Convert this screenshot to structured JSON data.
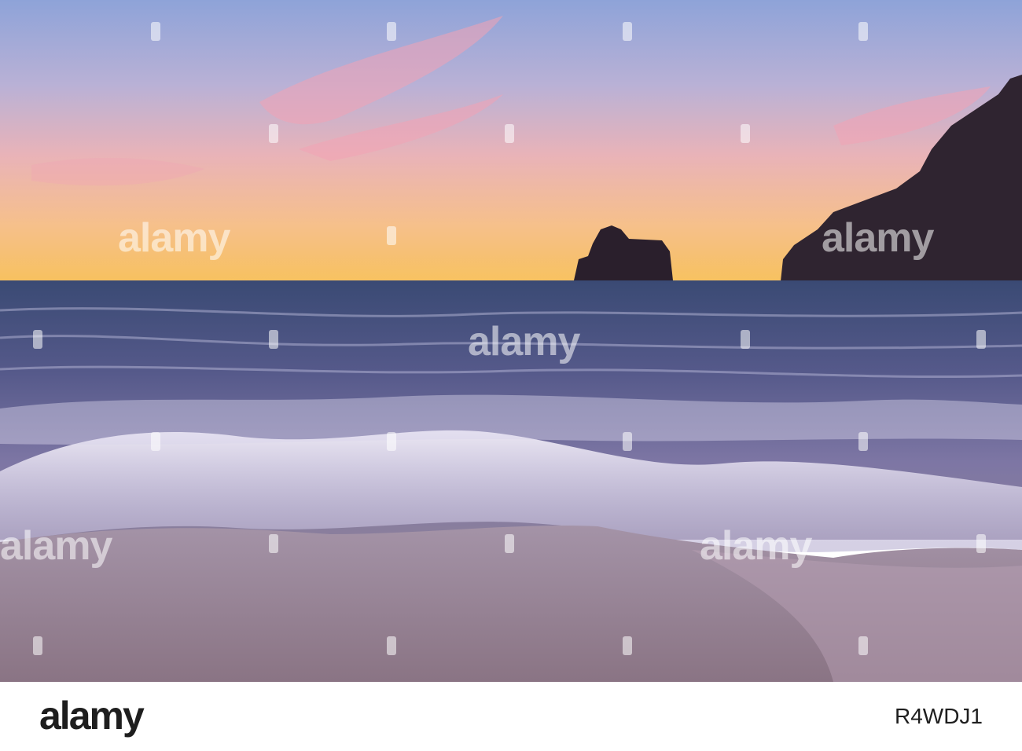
{
  "photo": {
    "description_icon": "sunset-sea-stack-icon",
    "watermark_text": "alamy"
  },
  "footer": {
    "brand": "alamy",
    "image_id": "R4WDJ1"
  },
  "colors": {
    "sky_top": "#8ea3d8",
    "sky_mid": "#e9b3b8",
    "sky_horizon": "#f7c15e",
    "sea_far": "#3f4f7a",
    "sea_near": "#6b6a99",
    "foam": "#e6e2f0",
    "sand": "#9a8695",
    "rock": "#2a1f2c",
    "footer_bg": "#ffffff",
    "footer_text": "#1e1e1e"
  }
}
